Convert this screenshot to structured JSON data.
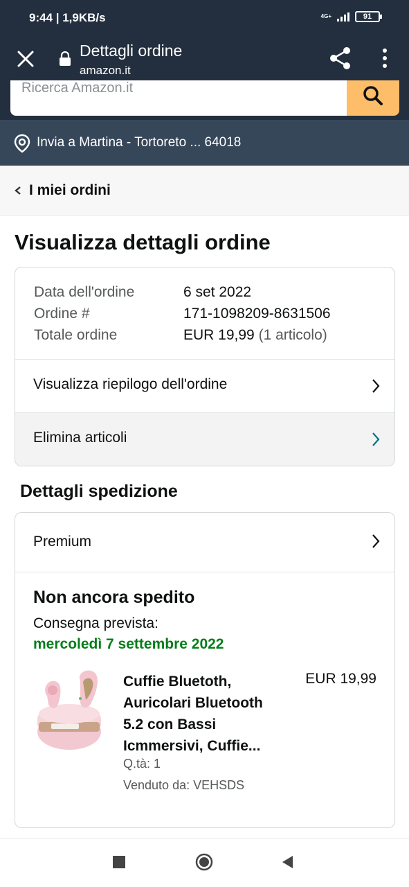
{
  "status_bar": {
    "time": "9:44 | 1,9KB/s",
    "network": "4G+",
    "battery": "91"
  },
  "browser": {
    "title": "Dettagli ordine",
    "domain": "amazon.it"
  },
  "search": {
    "placeholder": "Ricerca Amazon.it"
  },
  "delivery": {
    "text": "Invia a Martina - Tortoreto ... 64018"
  },
  "breadcrumb": {
    "back_label": "I miei ordini"
  },
  "page": {
    "title": "Visualizza dettagli ordine"
  },
  "order": {
    "date_label": "Data dell'ordine",
    "date_value": "6 set 2022",
    "number_label": "Ordine #",
    "number_value": "171-1098209-8631506",
    "total_label": "Totale ordine",
    "total_value": "EUR 19,99",
    "total_count": "(1 articolo)",
    "summary_link": "Visualizza riepilogo dell'ordine",
    "delete_link": "Elimina articoli"
  },
  "shipping": {
    "section_title": "Dettagli spedizione",
    "method": "Premium",
    "status": "Non ancora spedito",
    "eta_label": "Consegna prevista:",
    "eta_date": "mercoledì 7 settembre 2022",
    "product": {
      "title": "Cuffie Bluetoth, Auricolari Bluetooth 5.2 con Bassi Icmmersivi, Cuffie...",
      "price": "EUR 19,99",
      "qty": "Q.tà: 1",
      "seller": "Venduto da: VEHSDS"
    }
  },
  "colors": {
    "header": "#232f3e",
    "delivery_bar": "#37475a",
    "search_button": "#febd69",
    "eta_green": "#067d1a",
    "teal_chevron": "#007185"
  }
}
